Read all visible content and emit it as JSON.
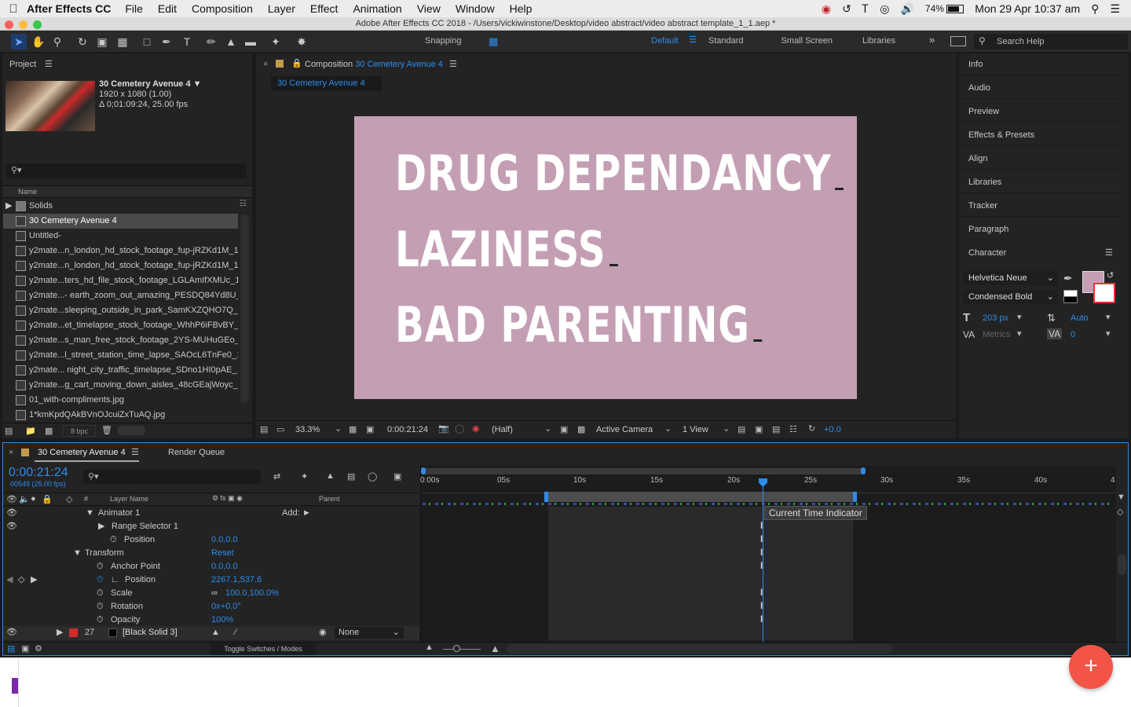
{
  "menubar": {
    "app_name": "After Effects CC",
    "items": [
      "File",
      "Edit",
      "Composition",
      "Layer",
      "Effect",
      "Animation",
      "View",
      "Window",
      "Help"
    ],
    "battery": "74%",
    "datetime": "Mon 29 Apr  10:37 am"
  },
  "window": {
    "title": "Adobe After Effects CC 2018 - /Users/vickiwinstone/Desktop/video abstract/video abstract template_1_1.aep *"
  },
  "toolbar": {
    "snapping": "Snapping",
    "workspaces": [
      "Default",
      "Standard",
      "Small Screen",
      "Libraries"
    ],
    "search_placeholder": "Search Help"
  },
  "project": {
    "title": "Project",
    "comp_name": "30 Cemetery Avenue 4",
    "comp_res": "1920 x 1080 (1.00)",
    "comp_dur": "Δ 0;01:09:24, 25.00 fps",
    "col_name": "Name",
    "items": [
      "Solids",
      "30 Cemetery Avenue 4",
      "Untitled-",
      "y2mate...n_london_hd_stock_footage_fup-jRZKd1M_1",
      "y2mate...n_london_hd_stock_footage_fup-jRZKd1M_1",
      "y2mate...ters_hd_file_stock_footage_LGLAmIfXMUc_1",
      "y2mate...- earth_zoom_out_amazing_PESDQ84Yd8U_",
      "y2mate...sleeping_outside_in_park_SamKXZQHO7Q_1",
      "y2mate...et_timelapse_stock_footage_WhhP6iFBvBY_1",
      "y2mate...s_man_free_stock_footage_2YS-MUHuGEo_1",
      "y2mate...l_street_station_time_lapse_SAOcL6TnFe0_1",
      "y2mate... night_city_traffic_timelapse_SDno1HI0pAE_1",
      "y2mate...g_cart_moving_down_aisles_48cGEajWoyc_1",
      "01_with-compliments.jpg",
      "1*kmKpdQAkBVnOJcuiZxTuAQ.jpg"
    ],
    "bpc": "8 bpc"
  },
  "composition": {
    "panel_label": "Composition",
    "name": "30 Cemetery Avenue 4",
    "tab": "30 Cemetery Avenue 4",
    "lines": [
      "DRUG DEPENDANCY",
      "LAZINESS",
      "BAD PARENTING"
    ],
    "bg_color": "#c49fb4",
    "zoom": "33.3%",
    "timecode": "0:00:21:24",
    "resolution": "(Half)",
    "camera": "Active Camera",
    "views": "1 View",
    "exposure": "+0.0"
  },
  "right_panels": [
    "Info",
    "Audio",
    "Preview",
    "Effects & Presets",
    "Align",
    "Libraries",
    "Tracker",
    "Paragraph"
  ],
  "character": {
    "title": "Character",
    "font": "Helvetica Neue",
    "style": "Condensed Bold",
    "size": "203 px",
    "leading": "Auto",
    "kerning": "Metrics",
    "tracking": "0",
    "fill_color": "#c49fb4"
  },
  "timeline": {
    "comp_tab": "30 Cemetery Avenue 4",
    "render_tab": "Render Queue",
    "timecode": "0:00:21:24",
    "frames": "00549 (25.00 fps)",
    "col_layer": "Layer Name",
    "col_parent": "Parent",
    "ruler": [
      "0:00s",
      "05s",
      "10s",
      "15s",
      "20s",
      "25s",
      "30s",
      "35s",
      "40s",
      "4"
    ],
    "tooltip": "Current Time Indicator",
    "rows": [
      {
        "label": "Animator 1",
        "value": "",
        "add": "Add:"
      },
      {
        "label": "Range Selector 1",
        "value": ""
      },
      {
        "label": "Position",
        "value": "0.0,0.0"
      },
      {
        "label": "Transform",
        "value": "Reset"
      },
      {
        "label": "Anchor Point",
        "value": "0.0,0.0"
      },
      {
        "label": "Position",
        "value": "2267.1,537.6"
      },
      {
        "label": "Scale",
        "value": "100.0,100.0%"
      },
      {
        "label": "Rotation",
        "value": "0x+0.0°"
      },
      {
        "label": "Opacity",
        "value": "100%"
      }
    ],
    "layer_num": "27",
    "layer_name": "[Black Solid 3]",
    "parent_value": "None",
    "toggle_label": "Toggle Switches / Modes"
  }
}
